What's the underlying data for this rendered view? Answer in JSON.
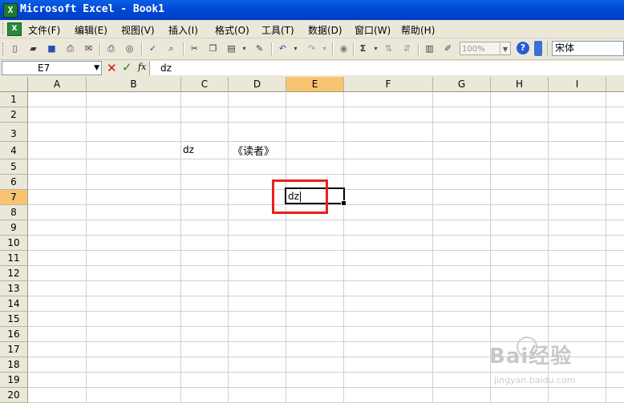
{
  "window": {
    "title": "Microsoft Excel - Book1",
    "app_icon": "X"
  },
  "menu": {
    "items": [
      "文件(F)",
      "编辑(E)",
      "视图(V)",
      "插入(I)",
      "格式(O)",
      "工具(T)",
      "数据(D)",
      "窗口(W)",
      "帮助(H)"
    ]
  },
  "toolbar": {
    "zoom": "100%",
    "font_name": "宋体",
    "help_label": "?"
  },
  "formula": {
    "name_box": "E7",
    "fx_label": "fx",
    "value": "dz"
  },
  "grid": {
    "columns": [
      "A",
      "B",
      "C",
      "D",
      "E",
      "F",
      "G",
      "H",
      "I"
    ],
    "rows": [
      "1",
      "2",
      "3",
      "4",
      "5",
      "6",
      "7",
      "8",
      "9",
      "10",
      "11",
      "12",
      "13",
      "14",
      "15",
      "16",
      "17",
      "18",
      "19",
      "20"
    ],
    "selected_column": "E",
    "selected_row": "7",
    "cells": {
      "C4": "dz",
      "D4": "《读者》",
      "E7": "dz"
    }
  },
  "watermark": {
    "brand": "Bai经验",
    "url": "jingyan.baidu.com"
  },
  "colors": {
    "title_bar": "#0049d6",
    "selection_header": "#f8c471",
    "highlight_box": "#e8201a"
  }
}
